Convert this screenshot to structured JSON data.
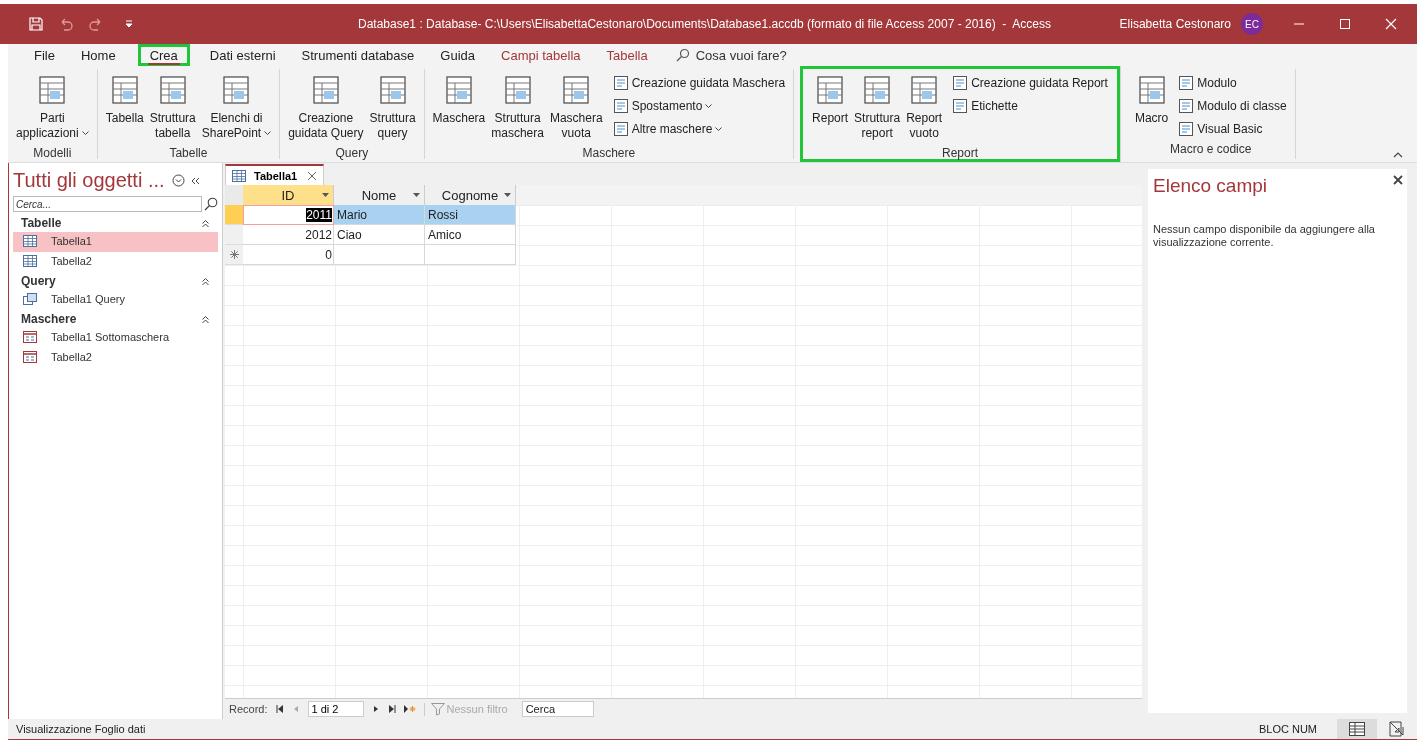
{
  "window": {
    "title": "Database1 : Database- C:\\Users\\ElisabettaCestonaro\\Documents\\Database1.accdb (formato di file Access 2007 - 2016)  -  Access",
    "user": "Elisabetta Cestonaro",
    "initials": "EC"
  },
  "tabs": [
    {
      "label": "File",
      "kind": "plain",
      "selected": false,
      "highlighted": false
    },
    {
      "label": "Home",
      "kind": "plain",
      "selected": false,
      "highlighted": false
    },
    {
      "label": "Crea",
      "kind": "plain",
      "selected": true,
      "highlighted": true
    },
    {
      "label": "Dati esterni",
      "kind": "plain",
      "selected": false,
      "highlighted": false
    },
    {
      "label": "Strumenti database",
      "kind": "plain",
      "selected": false,
      "highlighted": false
    },
    {
      "label": "Guida",
      "kind": "plain",
      "selected": false,
      "highlighted": false
    },
    {
      "label": "Campi tabella",
      "kind": "context",
      "selected": false,
      "highlighted": false
    },
    {
      "label": "Tabella",
      "kind": "context",
      "selected": false,
      "highlighted": false
    }
  ],
  "tell_me": {
    "placeholder": "Cosa vuoi fare?"
  },
  "ribbon_groups": [
    {
      "label": "Modelli",
      "highlighted": false,
      "items": [
        {
          "kind": "large",
          "lines": [
            "Parti",
            "applicazioni"
          ],
          "dropdown": true
        }
      ]
    },
    {
      "label": "Tabelle",
      "highlighted": false,
      "items": [
        {
          "kind": "large",
          "lines": [
            "Tabella"
          ],
          "dropdown": false
        },
        {
          "kind": "large",
          "lines": [
            "Struttura",
            "tabella"
          ],
          "dropdown": false
        },
        {
          "kind": "large",
          "lines": [
            "Elenchi di",
            "SharePoint"
          ],
          "dropdown": true
        }
      ]
    },
    {
      "label": "Query",
      "highlighted": false,
      "items": [
        {
          "kind": "large",
          "lines": [
            "Creazione",
            "guidata Query"
          ],
          "dropdown": false
        },
        {
          "kind": "large",
          "lines": [
            "Struttura",
            "query"
          ],
          "dropdown": false
        }
      ]
    },
    {
      "label": "Maschere",
      "highlighted": false,
      "items": [
        {
          "kind": "large",
          "lines": [
            "Maschera"
          ],
          "dropdown": false
        },
        {
          "kind": "large",
          "lines": [
            "Struttura",
            "maschera"
          ],
          "dropdown": false
        },
        {
          "kind": "large",
          "lines": [
            "Maschera",
            "vuota"
          ],
          "dropdown": false
        },
        {
          "kind": "stack",
          "items": [
            {
              "label": "Creazione guidata Maschera",
              "dropdown": false
            },
            {
              "label": "Spostamento",
              "dropdown": true
            },
            {
              "label": "Altre maschere",
              "dropdown": true
            }
          ]
        }
      ]
    },
    {
      "label": "Report",
      "highlighted": true,
      "items": [
        {
          "kind": "large",
          "lines": [
            "Report"
          ],
          "dropdown": false
        },
        {
          "kind": "large",
          "lines": [
            "Struttura",
            "report"
          ],
          "dropdown": false
        },
        {
          "kind": "large",
          "lines": [
            "Report",
            "vuoto"
          ],
          "dropdown": false
        },
        {
          "kind": "stack",
          "items": [
            {
              "label": "Creazione guidata Report",
              "dropdown": false
            },
            {
              "label": "Etichette",
              "dropdown": false
            }
          ]
        }
      ]
    },
    {
      "label": "Macro e codice",
      "highlighted": false,
      "items": [
        {
          "kind": "large",
          "lines": [
            "Macro"
          ],
          "dropdown": false
        },
        {
          "kind": "stack",
          "items": [
            {
              "label": "Modulo",
              "dropdown": false
            },
            {
              "label": "Modulo di classe",
              "dropdown": false
            },
            {
              "label": "Visual Basic",
              "dropdown": false
            }
          ]
        }
      ]
    }
  ],
  "nav_pane": {
    "title": "Tutti gli oggetti ...",
    "search": {
      "placeholder": "Cerca..."
    },
    "groups": [
      {
        "label": "Tabelle",
        "expanded": true,
        "items": [
          {
            "label": "Tabella1",
            "kind": "table",
            "selected": true
          },
          {
            "label": "Tabella2",
            "kind": "table",
            "selected": false
          }
        ]
      },
      {
        "label": "Query",
        "expanded": true,
        "items": [
          {
            "label": "Tabella1 Query",
            "kind": "query",
            "selected": false
          }
        ]
      },
      {
        "label": "Maschere",
        "expanded": true,
        "items": [
          {
            "label": "Tabella1 Sottomaschera",
            "kind": "form",
            "selected": false
          },
          {
            "label": "Tabella2",
            "kind": "form",
            "selected": false
          }
        ]
      }
    ]
  },
  "document_tabs": [
    {
      "label": "Tabella1",
      "selected": true
    }
  ],
  "table": {
    "columns": [
      {
        "label": "ID",
        "selected": true
      },
      {
        "label": "Nome",
        "selected": false
      },
      {
        "label": "Cognome",
        "selected": false
      }
    ],
    "rows": [
      {
        "kind": "record",
        "selected": true,
        "cells": [
          "2011",
          "Mario",
          "Rossi"
        ]
      },
      {
        "kind": "record",
        "selected": false,
        "cells": [
          "2012",
          "Ciao",
          "Amico"
        ]
      },
      {
        "kind": "new",
        "selected": false,
        "cells": [
          "0"
        ]
      }
    ]
  },
  "record_nav": {
    "label": "Record:",
    "position": "1 di 2",
    "filter": {
      "label": "Nessun filtro",
      "disabled": true
    },
    "search": {
      "placeholder": "Cerca"
    }
  },
  "field_list": {
    "title": "Elenco campi",
    "message": "Nessun campo disponibile da aggiungere alla visualizzazione corrente."
  },
  "status_bar": {
    "text": "Visualizzazione Foglio dati",
    "indicator": "BLOC NUM",
    "views": [
      {
        "kind": "datasheet",
        "selected": true
      },
      {
        "kind": "design",
        "selected": false
      }
    ]
  }
}
